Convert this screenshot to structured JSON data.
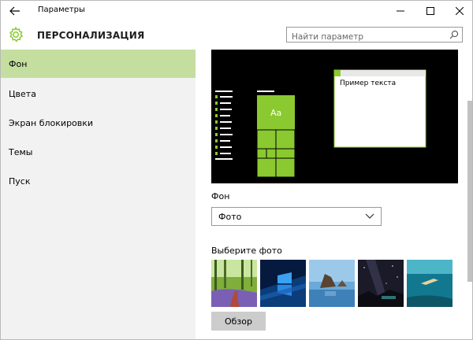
{
  "window": {
    "title": "Параметры"
  },
  "header": {
    "title": "ПЕРСОНАЛИЗАЦИЯ"
  },
  "search": {
    "placeholder": "Найти параметр",
    "value": ""
  },
  "sidebar": {
    "items": [
      {
        "label": "Фон",
        "active": true
      },
      {
        "label": "Цвета",
        "active": false
      },
      {
        "label": "Экран блокировки",
        "active": false
      },
      {
        "label": "Темы",
        "active": false
      },
      {
        "label": "Пуск",
        "active": false
      }
    ]
  },
  "preview": {
    "tile_label": "Aa",
    "sample_text": "Пример текста"
  },
  "background": {
    "label": "Фон",
    "selected": "Фото",
    "options": [
      "Фото"
    ]
  },
  "photos": {
    "label": "Выберите фото",
    "items": [
      "forest-path-photo",
      "windows-logo-photo",
      "beach-rocks-photo",
      "night-sky-photo",
      "underwater-diver-photo"
    ]
  },
  "browse": {
    "label": "Обзор"
  },
  "colors": {
    "accent": "#8ac92f",
    "sidebar_active": "#c4de9f",
    "sidebar_bg": "#f2f2f2",
    "preview_bg": "#000000"
  }
}
